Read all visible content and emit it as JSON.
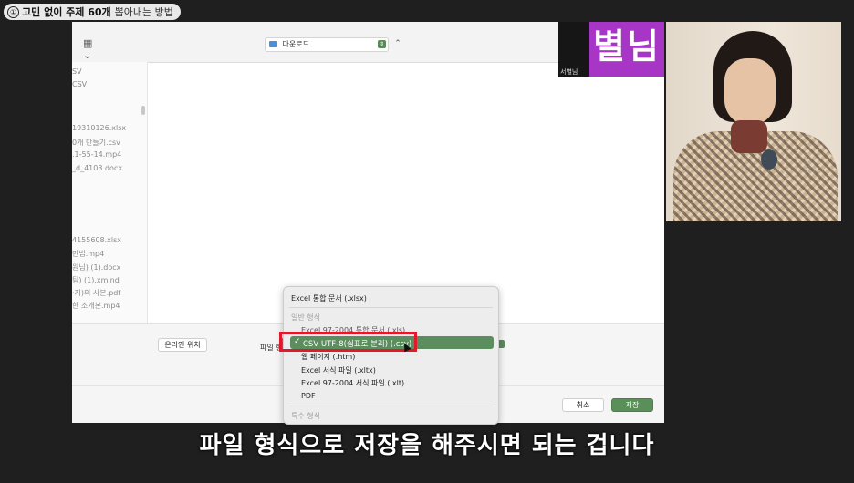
{
  "badge": {
    "number": "①",
    "bold": "고민 없이 주제 60개",
    "rest": "뽑아내는 방법"
  },
  "save_dialog": {
    "toolbar": {
      "view_icon": "▦ ⌄",
      "location": "다운로드",
      "expand_icon": "⌃"
    },
    "sidebar_files": [
      "SV",
      "CSV",
      "19310126.xlsx",
      "0개 만들기.csv",
      ".1-55-14.mp4",
      "_d_4103.docx",
      "4155608.xlsx",
      "만법.mp4",
      "원님) (1).docx",
      "팀) (1).xmind",
      "·지)의 사본.pdf",
      "한 소개본.mp4"
    ],
    "online_location_button": "온라인 위치",
    "file_format_label": "파일 형",
    "cancel_button": "취소",
    "save_button": "저장"
  },
  "format_menu": {
    "top_item": "Excel 통합 문서 (.xlsx)",
    "section_general": "일반 형식",
    "items_before": [
      "Excel 97-2004 통합 문서 (.xls)"
    ],
    "selected": {
      "check": "✓",
      "label": "CSV UTF-8(쉼표로 분리) (.csv)"
    },
    "items_after": [
      "웹 페이지 (.htm)",
      "Excel 서식 파일 (.xltx)",
      "Excel 97-2004 서식 파일 (.xlt)",
      "PDF"
    ],
    "section_special": "특수 형식"
  },
  "participant_tile": {
    "name_big": "별님",
    "name_small": "서별님"
  },
  "subtitle": "파일 형식으로 저장을 해주시면 되는 겁니다",
  "colors": {
    "highlight_green": "#5b8d5f",
    "annotation_red": "#e3182a",
    "tile_purple": "#a735c5"
  }
}
